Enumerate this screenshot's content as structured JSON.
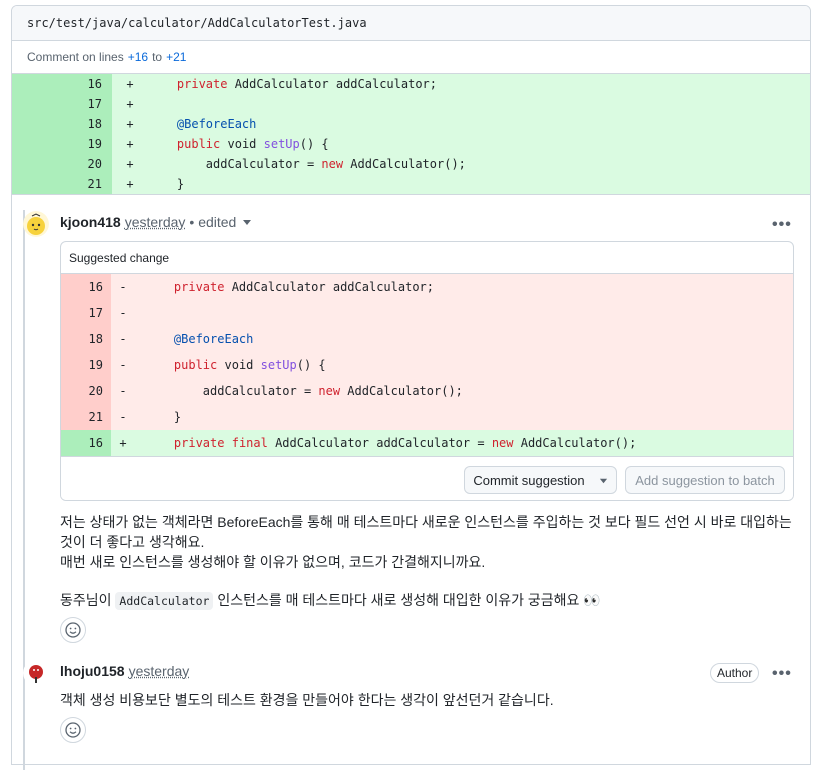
{
  "file": {
    "path": "src/test/java/calculator/AddCalculatorTest.java"
  },
  "comment_lines": {
    "prefix": "Comment on lines",
    "from": "+16",
    "to_word": "to",
    "to": "+21"
  },
  "context_rows": [
    {
      "num": "16",
      "sign": "+",
      "parts": [
        {
          "t": "    "
        },
        {
          "t": "private",
          "c": "kw"
        },
        {
          "t": " AddCalculator addCalculator;"
        }
      ]
    },
    {
      "num": "17",
      "sign": "+",
      "parts": [
        {
          "t": ""
        }
      ]
    },
    {
      "num": "18",
      "sign": "+",
      "parts": [
        {
          "t": "    "
        },
        {
          "t": "@BeforeEach",
          "c": "ann"
        }
      ]
    },
    {
      "num": "19",
      "sign": "+",
      "parts": [
        {
          "t": "    "
        },
        {
          "t": "public",
          "c": "kw"
        },
        {
          "t": " void "
        },
        {
          "t": "setUp",
          "c": "fn"
        },
        {
          "t": "() {"
        }
      ]
    },
    {
      "num": "20",
      "sign": "+",
      "parts": [
        {
          "t": "        addCalculator = "
        },
        {
          "t": "new",
          "c": "kw"
        },
        {
          "t": " AddCalculator();"
        }
      ]
    },
    {
      "num": "21",
      "sign": "+",
      "parts": [
        {
          "t": "    }"
        }
      ]
    }
  ],
  "comment1": {
    "user": "kjoon418",
    "when": "yesterday",
    "edited": "• edited",
    "more": "•••",
    "suggestion_header": "Suggested change",
    "rows": [
      {
        "type": "del",
        "num": "16",
        "sign": "-",
        "parts": [
          {
            "t": "    "
          },
          {
            "t": "private",
            "c": "kw"
          },
          {
            "t": " AddCalculator addCalculator;"
          }
        ]
      },
      {
        "type": "del",
        "num": "17",
        "sign": "-",
        "parts": [
          {
            "t": ""
          }
        ]
      },
      {
        "type": "del",
        "num": "18",
        "sign": "-",
        "parts": [
          {
            "t": "    "
          },
          {
            "t": "@BeforeEach",
            "c": "ann"
          }
        ]
      },
      {
        "type": "del",
        "num": "19",
        "sign": "-",
        "parts": [
          {
            "t": "    "
          },
          {
            "t": "public",
            "c": "kw"
          },
          {
            "t": " void "
          },
          {
            "t": "setUp",
            "c": "fn"
          },
          {
            "t": "() {"
          }
        ]
      },
      {
        "type": "del",
        "num": "20",
        "sign": "-",
        "parts": [
          {
            "t": "        addCalculator = "
          },
          {
            "t": "new",
            "c": "kw"
          },
          {
            "t": " AddCalculator();"
          }
        ]
      },
      {
        "type": "del",
        "num": "21",
        "sign": "-",
        "parts": [
          {
            "t": "    }"
          }
        ]
      },
      {
        "type": "add",
        "num": "16",
        "sign": "+",
        "parts": [
          {
            "t": "    "
          },
          {
            "t": "private",
            "c": "kw"
          },
          {
            "t": " "
          },
          {
            "t": "final",
            "c": "kw"
          },
          {
            "t": " AddCalculator addCalculator = "
          },
          {
            "t": "new",
            "c": "kw"
          },
          {
            "t": " AddCalculator();"
          }
        ]
      }
    ],
    "commit_label": "Commit suggestion",
    "batch_label": "Add suggestion to batch",
    "para1_line1": "저는 상태가 없는 객체라면 BeforeEach를 통해 매 테스트마다 새로운 인스턴스를 주입하는 것 보다 필드 선언 시 바로 대입하는",
    "para1_line2": "것이 더 좋다고 생각해요.",
    "para1_line3": "매번 새로 인스턴스를 생성해야 할 이유가 없으며, 코드가 간결해지니까요.",
    "para2_pre": "동주님이",
    "para2_code": "AddCalculator",
    "para2_post": "인스턴스를 매 테스트마다 새로 생성해 대입한 이유가 궁금해요 👀"
  },
  "comment2": {
    "user": "lhoju0158",
    "when": "yesterday",
    "badge": "Author",
    "more": "•••",
    "text": "객체 생성 비용보단 별도의 테스트 환경을 만들어야 한다는 생각이 앞선던거 같습니다."
  },
  "icons": {
    "smiley": "smiley-icon",
    "caret": "caret-down-icon"
  },
  "colors": {
    "add_bg": "#dafbe1",
    "add_num": "#aceebb",
    "del_bg": "#ffebe9",
    "del_num": "#ffcecb",
    "link": "#0969da"
  }
}
